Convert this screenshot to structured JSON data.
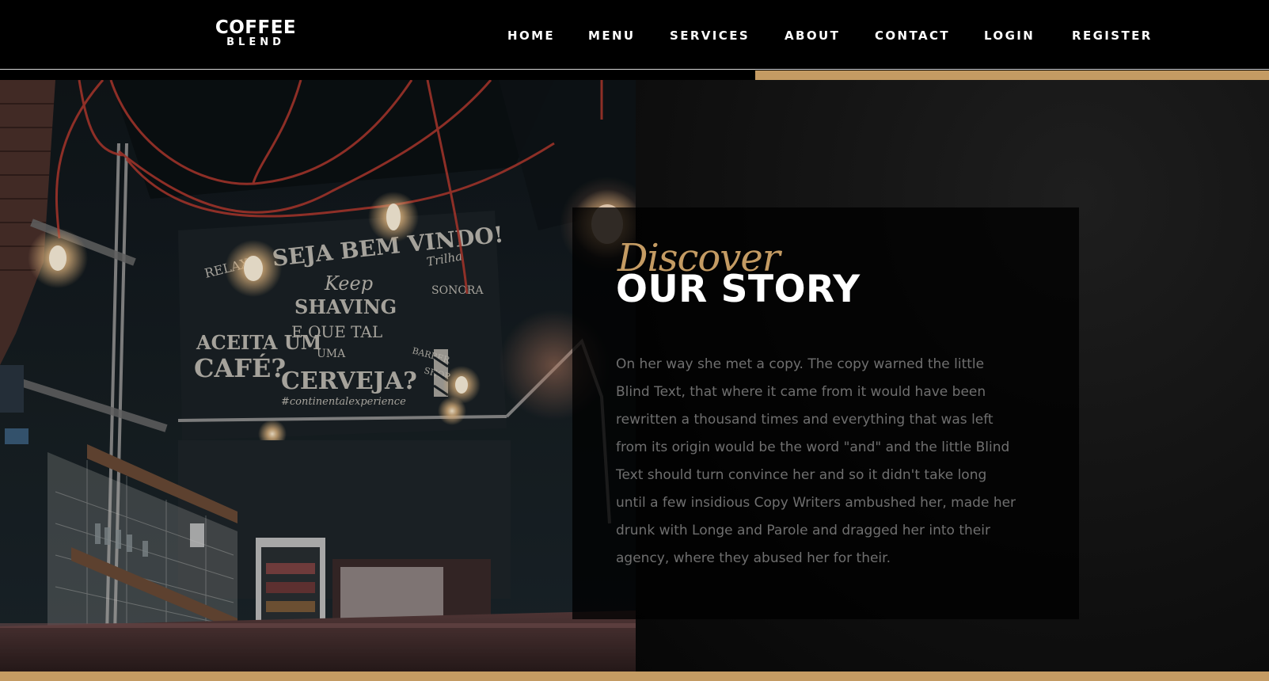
{
  "brand": {
    "name_top": "COFFEE",
    "name_bottom": "BLEND"
  },
  "nav": {
    "items": [
      {
        "label": "HOME"
      },
      {
        "label": "MENU"
      },
      {
        "label": "SERVICES"
      },
      {
        "label": "ABOUT"
      },
      {
        "label": "CONTACT"
      },
      {
        "label": "LOGIN"
      },
      {
        "label": "REGISTER"
      }
    ]
  },
  "about": {
    "subheading": "Discover",
    "heading": "OUR STORY",
    "paragraph": "On her way she met a copy. The copy warned the little Blind Text, that where it came from it would have been rewritten a thousand times and everything that was left from its origin would be the word \"and\" and the little Blind Text should turn convince her and so it didn't take long until a few insidious Copy Writers ambushed her, made her drunk with Longe and Parole and dragged her into their agency, where they abused her for their."
  },
  "image": {
    "mural_lines": [
      "RELAXE",
      "SEJA BEM VINDO!",
      "Keep",
      "SHAVING",
      "E QUE TAL",
      "UMA",
      "CERVEJA?",
      "ACEITA UM",
      "CAFÉ?",
      "Trilha",
      "SONORA",
      "BARBER",
      "SHOP",
      "#continentalexperience"
    ]
  },
  "colors": {
    "accent": "#c49b63",
    "background": "#000000",
    "text_muted": "#6f6f6f",
    "heading": "#ffffff"
  }
}
